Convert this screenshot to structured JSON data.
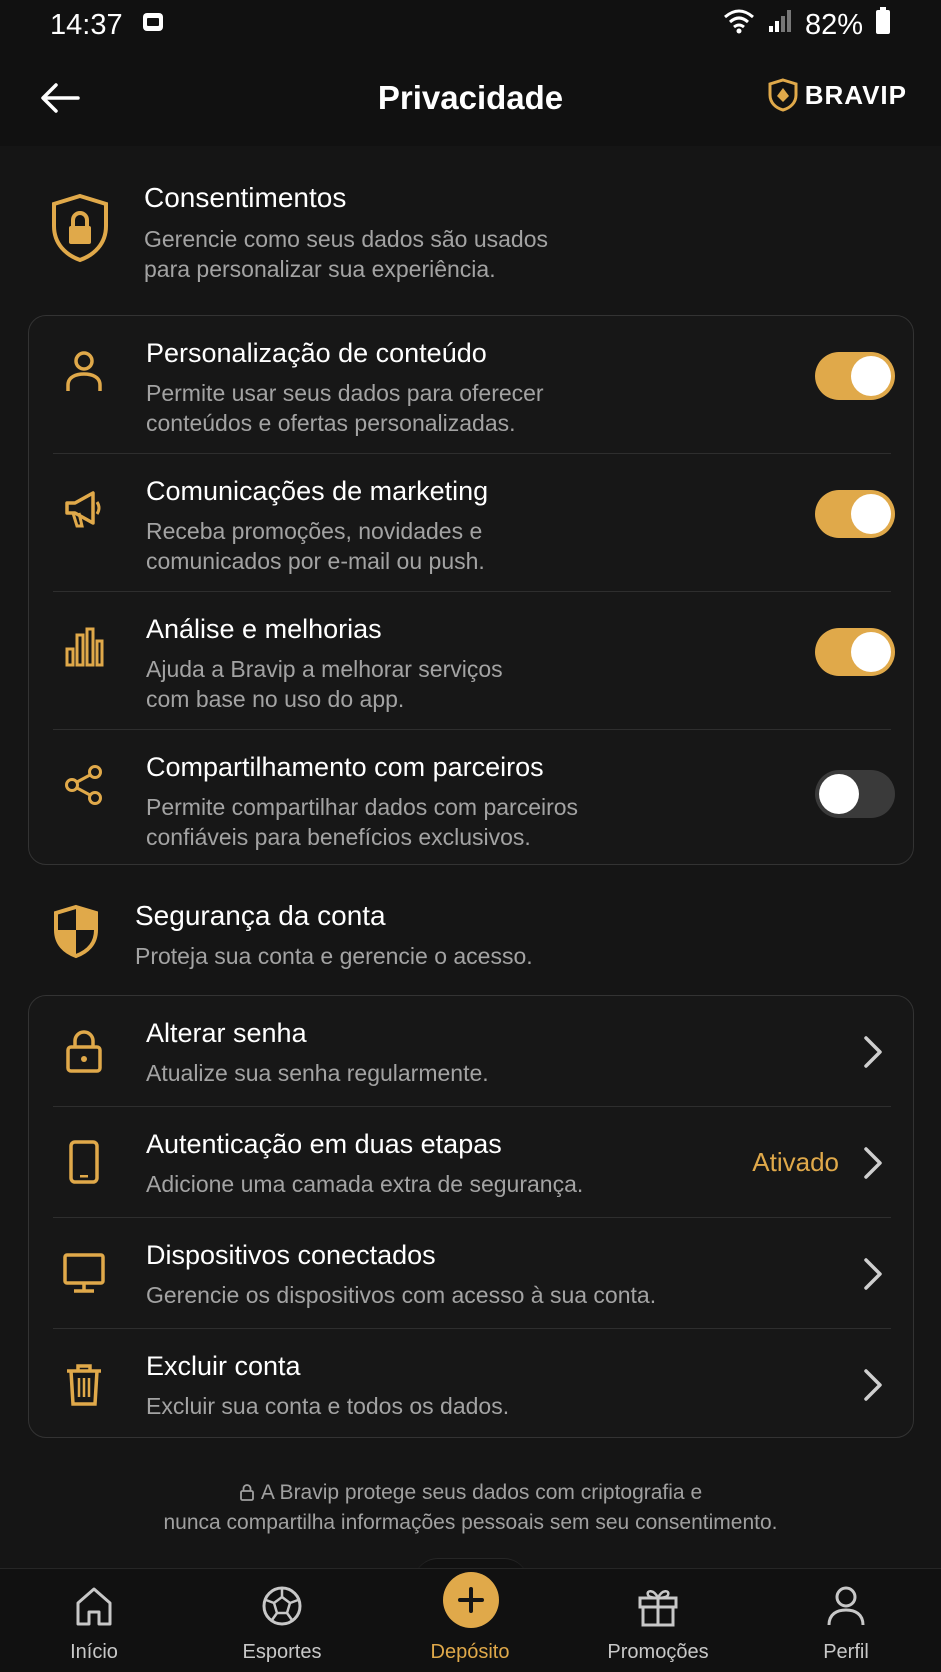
{
  "status_bar": {
    "time": "14:37",
    "battery": "82%"
  },
  "header": {
    "title": "Privacidade",
    "brand": "BRAVIP"
  },
  "consent_section": {
    "title": "Consentimentos",
    "subtitle_line1": "Gerencie como seus dados são usados",
    "subtitle_line2": "para personalizar sua experiência.",
    "items": [
      {
        "title": "Personalização de conteúdo",
        "desc1": "Permite usar seus dados para oferecer",
        "desc2": "conteúdos e ofertas personalizadas.",
        "enabled": true,
        "icon": "user-icon"
      },
      {
        "title": "Comunicações de marketing",
        "desc1": "Receba promoções, novidades e",
        "desc2": "comunicados por e-mail ou push.",
        "enabled": true,
        "icon": "megaphone-icon"
      },
      {
        "title": "Análise e melhorias",
        "desc1": "Ajuda a Bravip a melhorar serviços",
        "desc2": "com base no uso do app.",
        "enabled": true,
        "icon": "bar-chart-icon"
      },
      {
        "title": "Compartilhamento com parceiros",
        "desc1": "Permite compartilhar dados com parceiros",
        "desc2": "confiáveis para benefícios exclusivos.",
        "enabled": false,
        "icon": "share-icon"
      }
    ]
  },
  "security_section": {
    "title": "Segurança da conta",
    "subtitle": "Proteja sua conta e gerencie o acesso.",
    "items": [
      {
        "title": "Alterar senha",
        "desc": "Atualize sua senha regularmente.",
        "icon": "lock-icon"
      },
      {
        "title": "Autenticação em duas etapas",
        "desc": "Adicione uma camada extra de segurança.",
        "value": "Ativado",
        "icon": "phone-icon"
      },
      {
        "title": "Dispositivos conectados",
        "desc": "Gerencie os dispositivos com acesso à sua conta.",
        "icon": "monitor-icon"
      },
      {
        "title": "Excluir conta",
        "desc": "Excluir sua conta e todos os dados.",
        "icon": "trash-icon"
      }
    ]
  },
  "footer_note": {
    "line1": "A Bravip protege seus dados com criptografia e",
    "line2": "nunca compartilha informações pessoais sem seu consentimento."
  },
  "bottom_nav": [
    {
      "label": "Início",
      "icon": "home-icon"
    },
    {
      "label": "Esportes",
      "icon": "soccer-ball-icon"
    },
    {
      "label": "Depósito",
      "icon": "plus-icon",
      "active": true
    },
    {
      "label": "Promoções",
      "icon": "gift-icon"
    },
    {
      "label": "Perfil",
      "icon": "person-icon"
    }
  ],
  "colors": {
    "accent": "#e0a94a",
    "background": "#151515",
    "card": "#171717"
  }
}
